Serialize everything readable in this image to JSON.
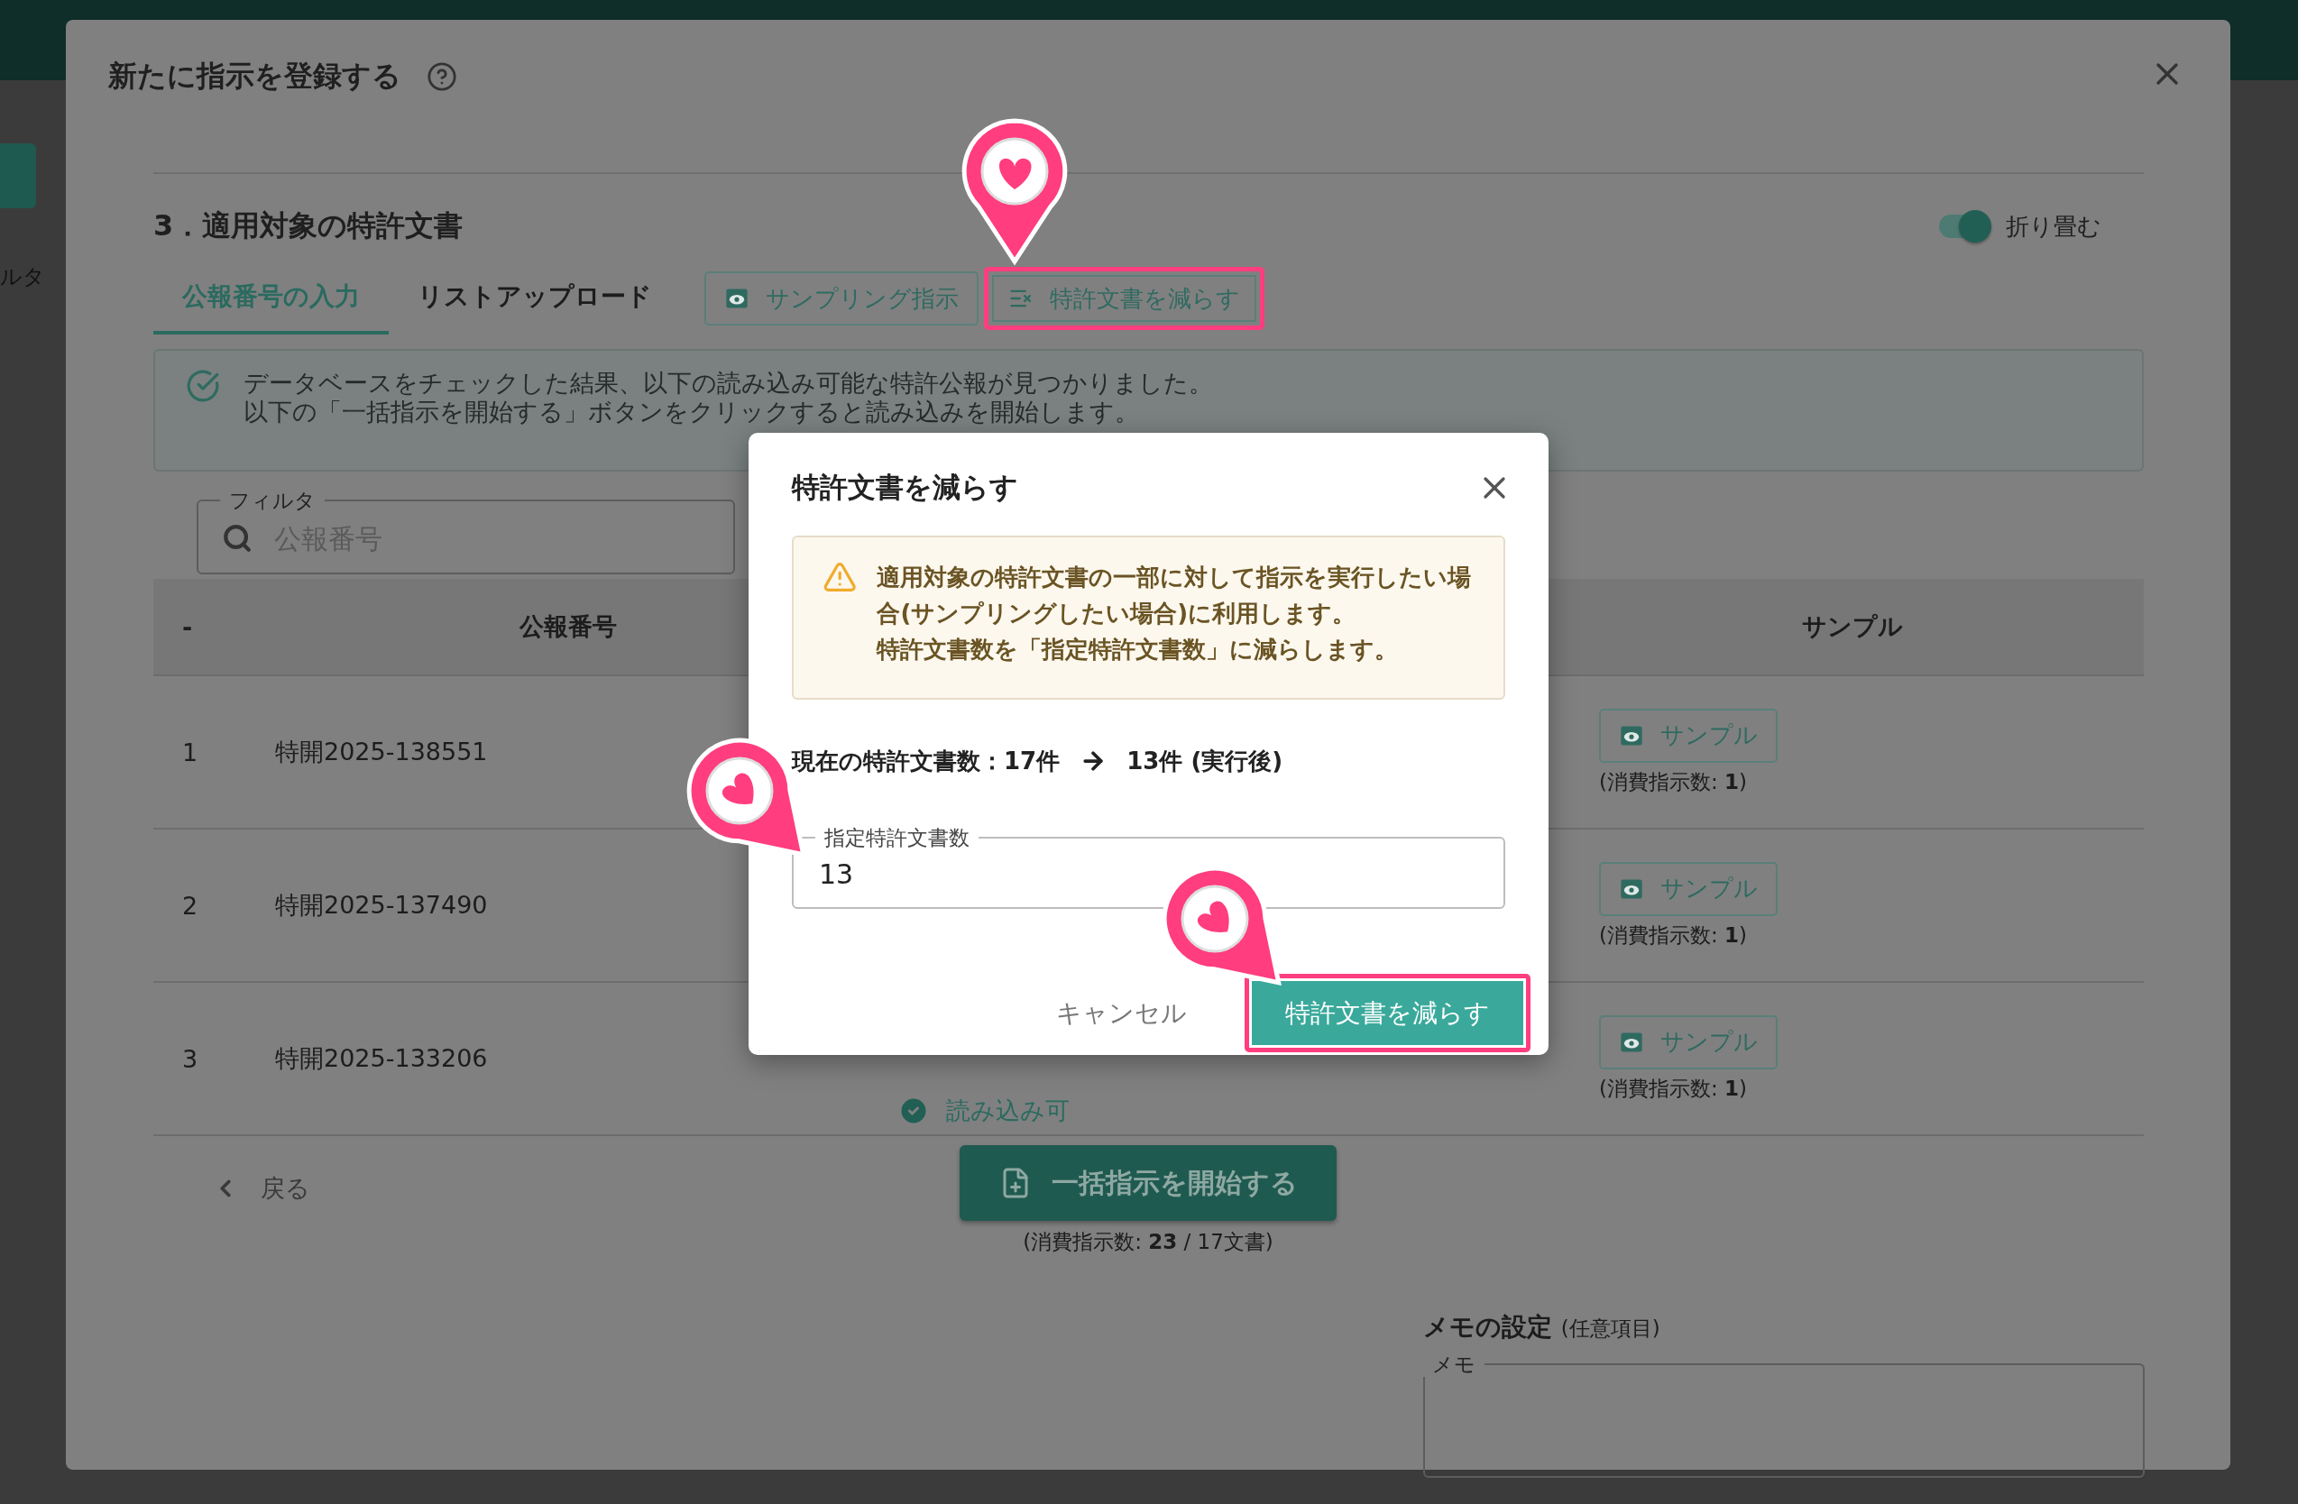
{
  "background": {
    "side_label": "ルタ"
  },
  "modal": {
    "title": "新たに指示を登録する",
    "section_title": "3．適用対象の特許文書",
    "collapse_toggle": {
      "label": "折り畳む",
      "on": true
    },
    "tabs": [
      {
        "label": "公報番号の入力",
        "selected": true
      },
      {
        "label": "リストアップロード",
        "selected": false
      }
    ],
    "actions": [
      {
        "label": "サンプリング指示",
        "kind": "eye"
      },
      {
        "label": "特許文書を減らす",
        "kind": "reduce",
        "highlighted": true
      }
    ],
    "alert": {
      "lines": [
        "データベースをチェックした結果、以下の読み込み可能な特許公報が見つかりました。",
        "以下の「一括指示を開始する」ボタンをクリックすると読み込みを開始します。"
      ]
    },
    "filter": {
      "label": "フィルタ",
      "placeholder": "公報番号"
    },
    "table": {
      "columns": [
        "-",
        "公報番号",
        "サンプル"
      ],
      "rows": [
        {
          "index": "1",
          "number": "特開2025-138551",
          "sample_button": "サンプル",
          "cost": "(消費指示数: **1**)"
        },
        {
          "index": "2",
          "number": "特開2025-137490",
          "sample_button": "サンプル",
          "cost": "(消費指示数: **1**)"
        },
        {
          "index": "3",
          "number": "特開2025-133206",
          "status": "読み込み可",
          "sample_button": "サンプル",
          "cost": "(消費指示数: **1**)"
        }
      ]
    },
    "back_link": "戻る",
    "start_button": "一括指示を開始する",
    "start_note": "(消費指示数: **23** / 17文書)",
    "memo": {
      "title": "メモの設定",
      "optional": "(任意項目)",
      "label": "メモ"
    }
  },
  "dialog": {
    "title": "特許文書を減らす",
    "warning": [
      "適用対象の特許文書の一部に対して指示を実行したい場合(サンプリングしたい場合)に利用します。",
      "特許文書数を「指定特許文書数」に減らします。"
    ],
    "count_current": "現在の特許文書数：17件",
    "count_after": "13件 (実行後)",
    "field": {
      "label": "指定特許文書数",
      "value": "13"
    },
    "cancel": "キャンセル",
    "confirm": {
      "label": "特許文書を減らす",
      "highlighted": true
    }
  }
}
